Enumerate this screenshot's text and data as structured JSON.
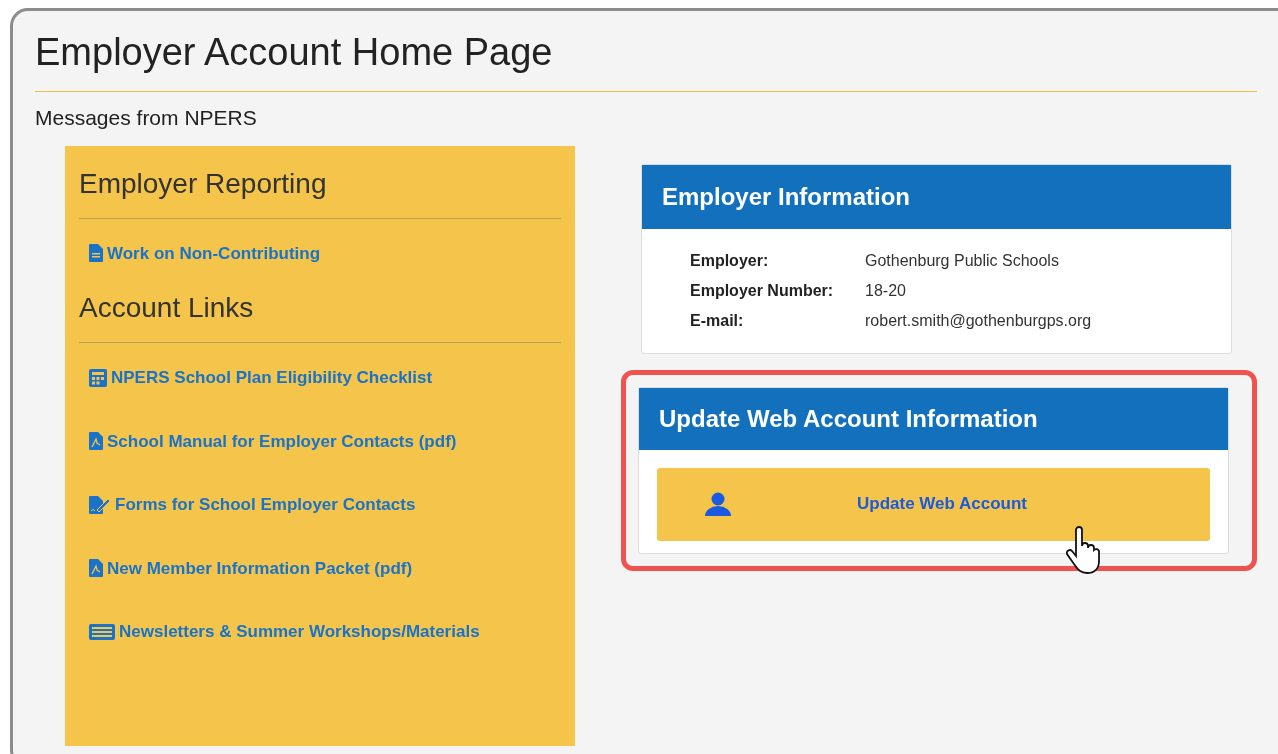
{
  "page_title": "Employer Account Home Page",
  "messages_heading": "Messages from NPERS",
  "sidebar": {
    "sections": [
      {
        "heading": "Employer Reporting",
        "links": [
          {
            "kind": "document",
            "label": "Work on Non-Contributing"
          }
        ]
      },
      {
        "heading": "Account Links",
        "links": [
          {
            "kind": "calculator",
            "label": "NPERS School Plan Eligibility Checklist"
          },
          {
            "kind": "pdf",
            "label": "School Manual for Employer Contacts (pdf)"
          },
          {
            "kind": "signature",
            "label": "Forms for School Employer Contacts"
          },
          {
            "kind": "pdf",
            "label": "New Member Information Packet (pdf)"
          },
          {
            "kind": "newspaper",
            "label": "Newsletters & Summer Workshops/Materials"
          }
        ]
      }
    ]
  },
  "employer_info": {
    "title": "Employer Information",
    "rows": [
      {
        "label": "Employer:",
        "value": "Gothenburg Public Schools"
      },
      {
        "label": "Employer Number:",
        "value": "18-20"
      },
      {
        "label": "E-mail:",
        "value": "robert.smith@gothenburgps.org"
      }
    ]
  },
  "update_account": {
    "title": "Update Web Account Information",
    "highlighted": true,
    "button": "Update Web Account"
  }
}
